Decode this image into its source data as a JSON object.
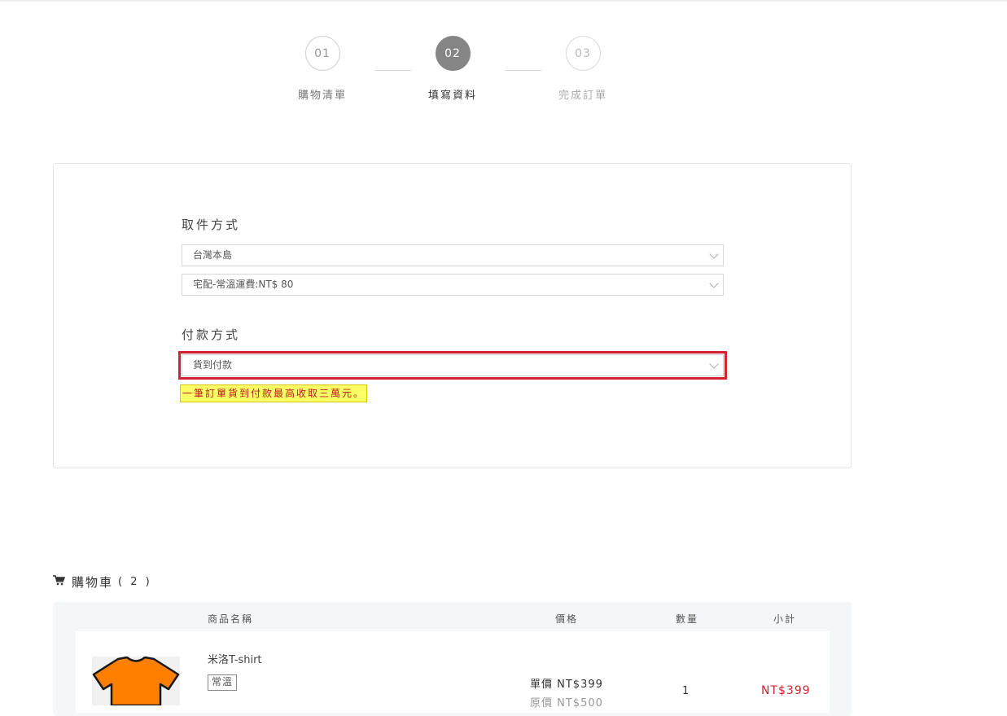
{
  "steps": [
    {
      "number": "01",
      "label": "購物清單"
    },
    {
      "number": "02",
      "label": "填寫資料"
    },
    {
      "number": "03",
      "label": "完成訂單"
    }
  ],
  "pickup": {
    "title": "取件方式",
    "region_value": "台灣本島",
    "shipping_value": "宅配-常溫運費:NT$ 80"
  },
  "payment": {
    "title": "付款方式",
    "method_value": "貨到付款",
    "notice": "一筆訂單貨到付款最高收取三萬元。"
  },
  "cart": {
    "title": "購物車",
    "count": "( 2 )",
    "headers": {
      "name": "商品名稱",
      "price": "價格",
      "qty": "數量",
      "subtotal": "小計"
    },
    "items": [
      {
        "name": "米洛T-shirt",
        "tag": "常溫",
        "unit_price": "單價 NT$399",
        "original_price": "原價 NT$500",
        "qty": "1",
        "subtotal": "NT$399",
        "image_color": "#ff7f00"
      }
    ]
  },
  "colors": {
    "accent_red": "#d0232e",
    "notice_bg": "#ffff66",
    "active_step": "#858585"
  }
}
